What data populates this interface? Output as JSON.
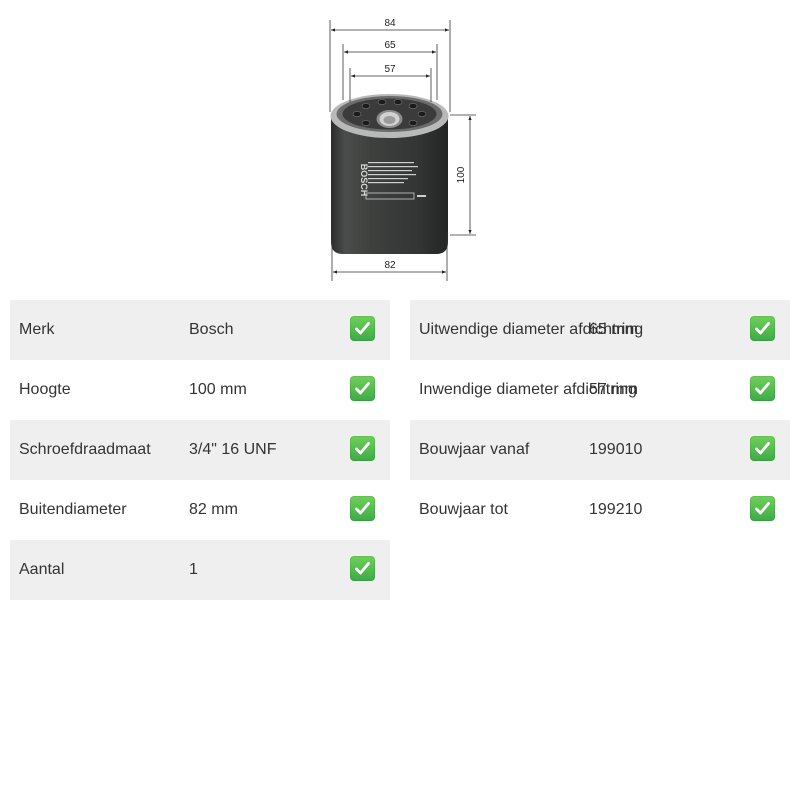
{
  "drawing": {
    "brand_mark": "BOSCH",
    "dimensions": {
      "top_outer": "84",
      "gasket_outer": "65",
      "gasket_inner": "57",
      "height": "100",
      "body_diameter": "82"
    }
  },
  "specs": {
    "left": [
      {
        "label": "Merk",
        "value": "Bosch",
        "icon": "check-icon"
      },
      {
        "label": "Hoogte",
        "value": "100 mm",
        "icon": "check-icon"
      },
      {
        "label": "Schroefdraadmaat",
        "value": "3/4\" 16 UNF",
        "icon": "check-icon"
      },
      {
        "label": "Buitendiameter",
        "value": "82 mm",
        "icon": "check-icon"
      },
      {
        "label": "Aantal",
        "value": "1",
        "icon": "check-icon"
      }
    ],
    "right": [
      {
        "label": "Uitwendige diameter afdichtring",
        "value": "65 mm",
        "icon": "check-icon"
      },
      {
        "label": "Inwendige diameter afdichtring",
        "value": "57 mm",
        "icon": "check-icon"
      },
      {
        "label": "Bouwjaar vanaf",
        "value": "199010",
        "icon": "check-icon"
      },
      {
        "label": "Bouwjaar tot",
        "value": "199210",
        "icon": "check-icon"
      }
    ]
  },
  "colors": {
    "check": "#3daa48",
    "row_alt": "#efefef",
    "text": "#333333"
  }
}
